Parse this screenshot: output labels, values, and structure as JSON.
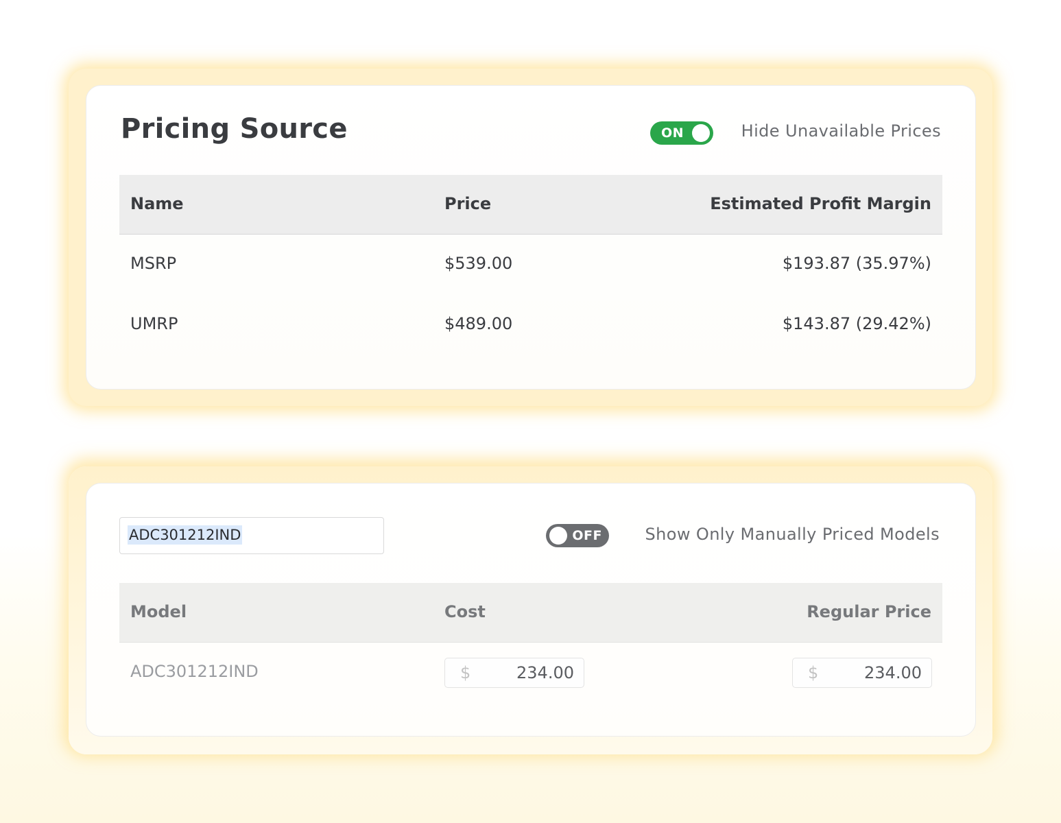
{
  "pricing_source": {
    "title": "Pricing Source",
    "toggle": {
      "label": "ON",
      "state": "on",
      "caption": "Hide Unavailable Prices"
    },
    "columns": [
      "Name",
      "Price",
      "Estimated Profit Margin"
    ],
    "rows": [
      {
        "name": "MSRP",
        "price": "$539.00",
        "margin": "$193.87 (35.97%)"
      },
      {
        "name": "UMRP",
        "price": "$489.00",
        "margin": "$143.87 (29.42%)"
      }
    ]
  },
  "models": {
    "search": {
      "value": "ADC301212IND"
    },
    "toggle": {
      "label": "OFF",
      "state": "off",
      "caption": "Show Only Manually Priced Models"
    },
    "columns": [
      "Model",
      "Cost",
      "Regular Price"
    ],
    "rows": [
      {
        "model": "ADC301212IND",
        "cost": {
          "currency": "$",
          "amount": "234.00"
        },
        "regular_price": {
          "currency": "$",
          "amount": "234.00"
        }
      }
    ]
  },
  "colors": {
    "toggle_on": "#2aa64a",
    "toggle_off": "#6b6d70",
    "glow": "#ffd666"
  }
}
